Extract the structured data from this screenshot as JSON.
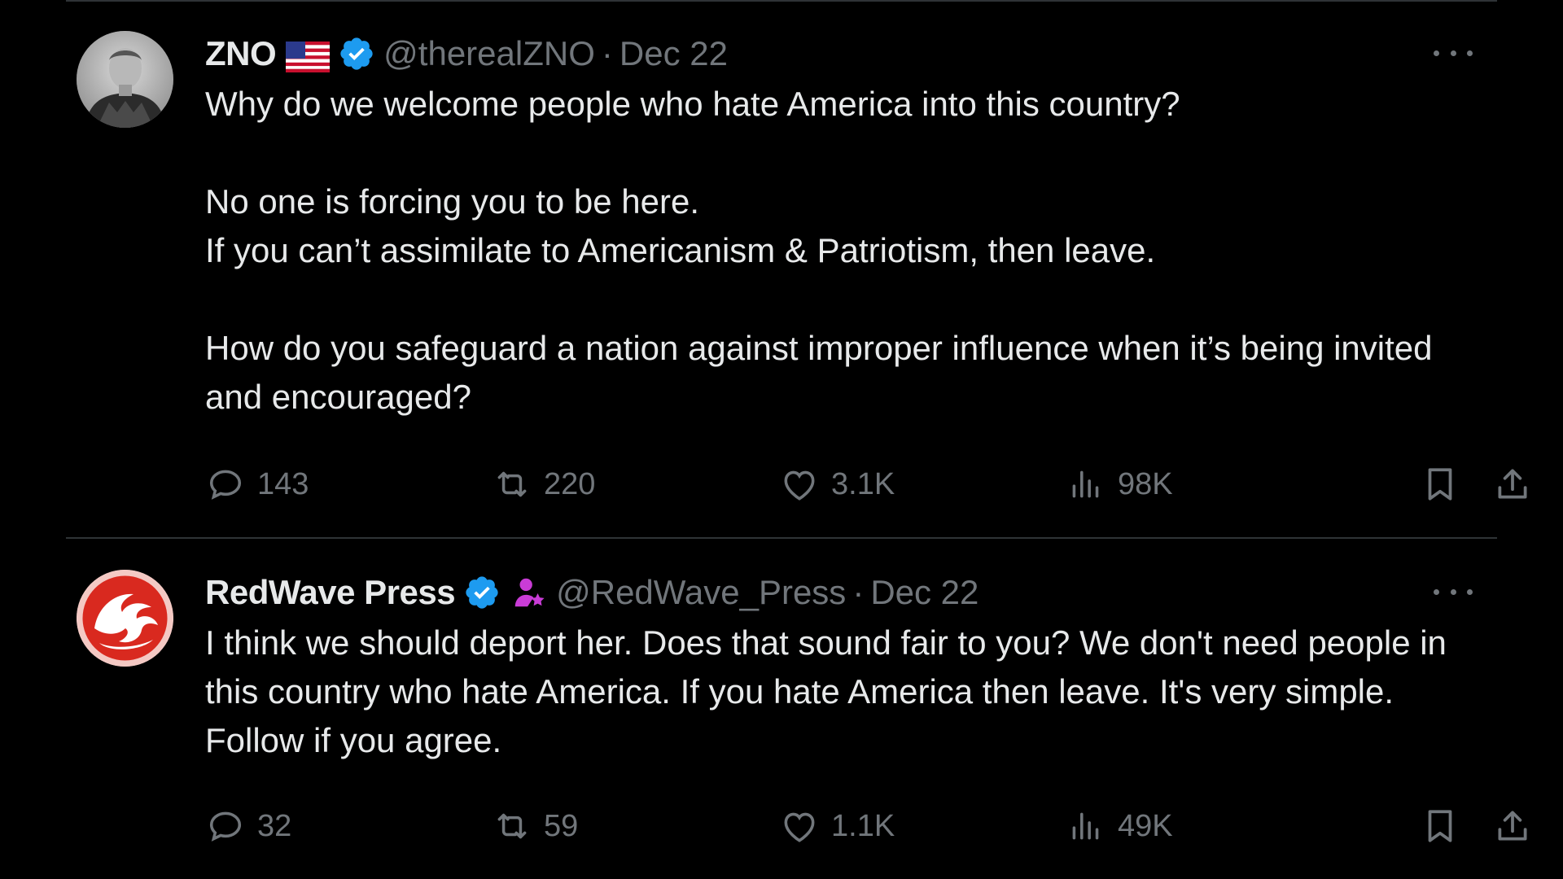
{
  "tweets": [
    {
      "display_name": "ZNO",
      "handle": "@therealZNO",
      "separator": "·",
      "date": "Dec 22",
      "body": [
        "Why do we welcome people who hate America into this country?",
        "No one is forcing you to be here.\nIf you can’t assimilate to Americanism & Patriotism, then leave.",
        "How do you safeguard a nation against improper influence when it’s being invited and encouraged?"
      ],
      "replies": "143",
      "reposts": "220",
      "likes": "3.1K",
      "views": "98K",
      "icons": [
        "us-flag-icon",
        "verified-badge-icon",
        "more-icon",
        "reply-icon",
        "repost-icon",
        "like-icon",
        "views-icon",
        "bookmark-icon",
        "share-icon"
      ]
    },
    {
      "display_name": "RedWave Press",
      "handle": "@RedWave_Press",
      "separator": "·",
      "date": "Dec 22",
      "body": [
        "I think we should deport her. Does that sound fair to you? We don't need people in this country who hate America. If you hate America then leave. It's very simple. Follow if you agree."
      ],
      "replies": "32",
      "reposts": "59",
      "likes": "1.1K",
      "views": "49K",
      "icons": [
        "verified-badge-icon",
        "affiliate-person-icon",
        "more-icon",
        "reply-icon",
        "repost-icon",
        "like-icon",
        "views-icon",
        "bookmark-icon",
        "share-icon"
      ]
    }
  ],
  "colors": {
    "background": "#000000",
    "text_primary": "#e7e9ea",
    "text_secondary": "#71767b",
    "verified_blue": "#1d9bf0",
    "affiliate_purple": "#c93cd6",
    "divider": "#2f3336"
  }
}
